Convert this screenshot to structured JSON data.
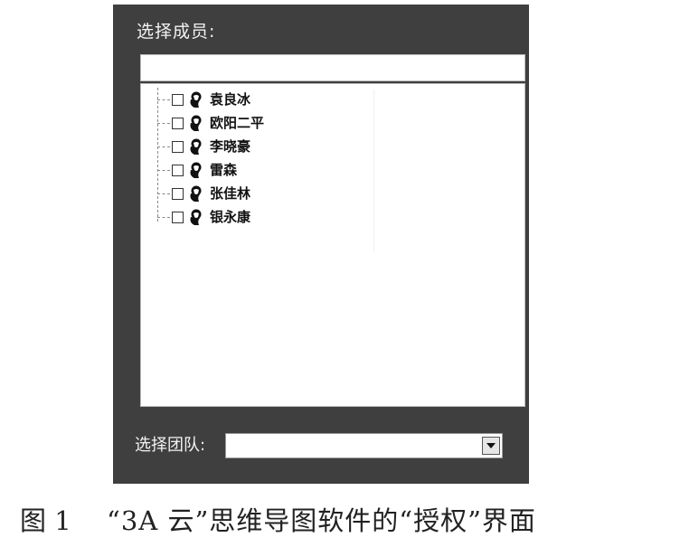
{
  "panel": {
    "title": "选择成员:",
    "search": {
      "value": "",
      "placeholder": ""
    },
    "members": [
      {
        "name": "袁良冰",
        "checked": false,
        "icon": "user-icon"
      },
      {
        "name": "欧阳二平",
        "checked": false,
        "icon": "user-icon"
      },
      {
        "name": "李晓豪",
        "checked": false,
        "icon": "user-icon"
      },
      {
        "name": "雷森",
        "checked": false,
        "icon": "user-icon"
      },
      {
        "name": "张佳林",
        "checked": false,
        "icon": "user-icon"
      },
      {
        "name": "银永康",
        "checked": false,
        "icon": "user-icon"
      }
    ],
    "team": {
      "label": "选择团队:",
      "selected": "",
      "icon": "chevron-down-icon"
    }
  },
  "caption": {
    "figure_number": "图 1",
    "text": "“3A 云”思维导图软件的“授权”界面"
  },
  "colors": {
    "panel_bg": "#3f3f3f",
    "panel_text": "#f2f2f2",
    "box_bg": "#ffffff"
  }
}
